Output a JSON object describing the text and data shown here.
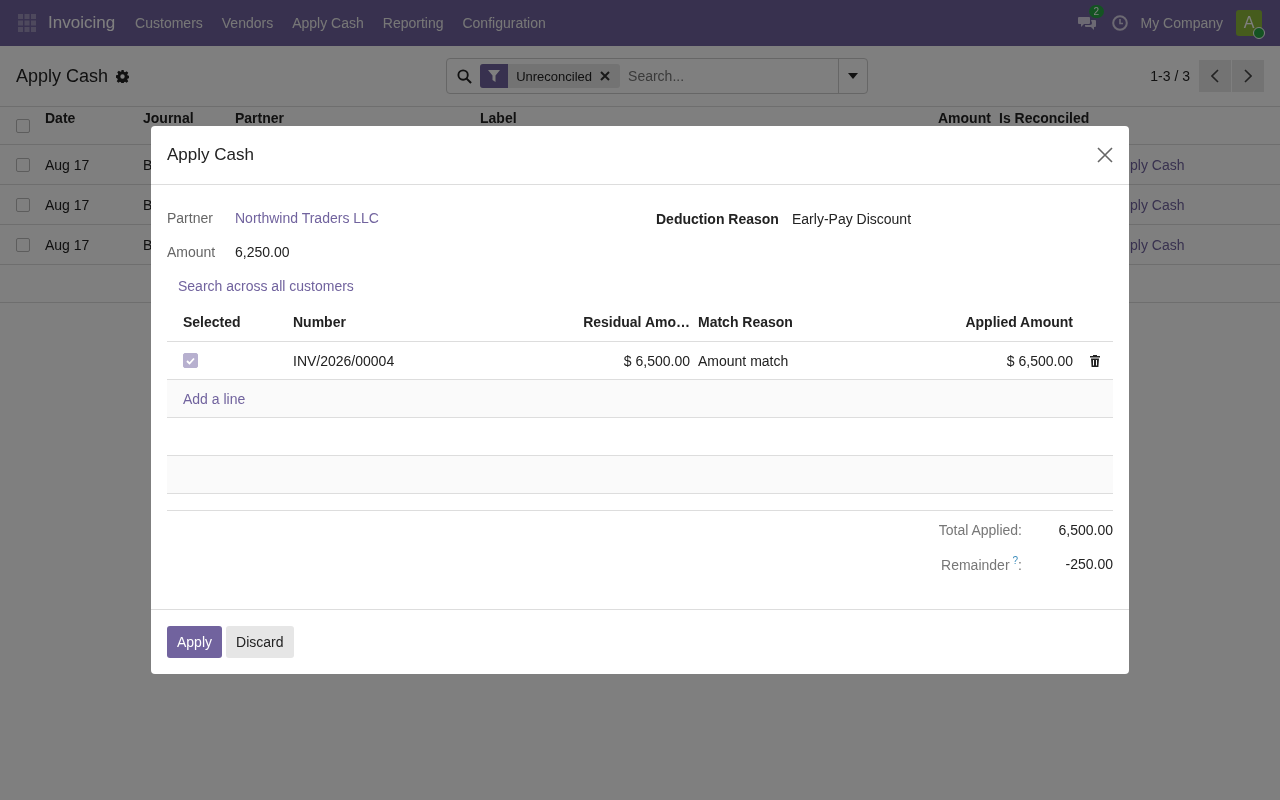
{
  "navbar": {
    "app_name": "Invoicing",
    "menu": [
      "Customers",
      "Vendors",
      "Apply Cash",
      "Reporting",
      "Configuration"
    ],
    "messages_badge": "2",
    "company": "My Company",
    "avatar": "A"
  },
  "control_panel": {
    "title": "Apply Cash",
    "search": {
      "facet": "Unreconciled",
      "placeholder": "Search..."
    },
    "pager": "1-3 / 3"
  },
  "list": {
    "select_all_checked": false,
    "columns": [
      "Date",
      "Journal",
      "Partner",
      "Label",
      "Amount",
      "Is Reconciled"
    ],
    "rows": [
      {
        "checked": false,
        "date": "Aug 17",
        "column_2": "B",
        "column_6": "ply Cash"
      },
      {
        "checked": false,
        "date": "Aug 17",
        "column_2": "B",
        "column_6": "ply Cash"
      },
      {
        "checked": false,
        "date": "Aug 17",
        "column_2": "B",
        "column_6": "ply Cash"
      }
    ]
  },
  "dialog": {
    "title": "Apply Cash",
    "fields": [
      {
        "label": "Partner",
        "value": "Northwind Traders LLC",
        "kind": "link"
      },
      {
        "label": "Amount",
        "value": "6,250.00",
        "kind": "text"
      }
    ],
    "deduction": {
      "label": "Deduction Reason",
      "value": "Early-Pay Discount"
    },
    "search_link": "Search across all customers",
    "lines": {
      "columns": [
        "Selected",
        "Number",
        "Residual Amo…",
        "Match Reason",
        "Applied Amount"
      ],
      "rows": [
        {
          "selected": true,
          "number": "INV/2026/00004",
          "residual": "$ 6,500.00",
          "reason": "Amount match",
          "applied": "$ 6,500.00"
        }
      ],
      "add_line": "Add a line"
    },
    "totals": [
      {
        "label": "Total Applied:",
        "value": "6,500.00"
      },
      {
        "label": "Remainder",
        "help": "?",
        "suffix": ":",
        "value": "-250.00"
      }
    ],
    "buttons": [
      {
        "label": "Apply",
        "kind": "primary"
      },
      {
        "label": "Discard",
        "kind": "secondary"
      }
    ]
  }
}
